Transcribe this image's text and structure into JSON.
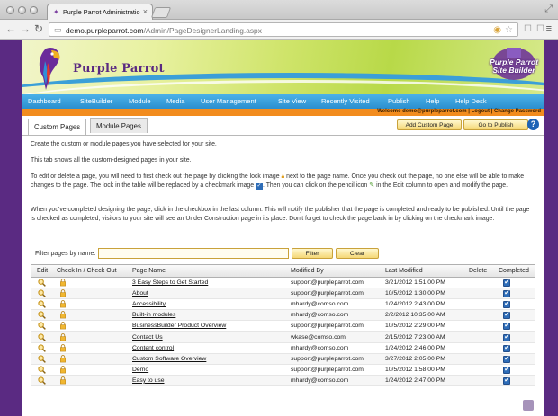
{
  "browser": {
    "tab_title": "Purple Parrot Administratio",
    "url_domain": "demo.purpleparrot.com",
    "url_path": "/Admin/PageDesignerLanding.aspx"
  },
  "brand": {
    "name": "Purple Parrot",
    "site_builder_line1": "Purple Parrot",
    "site_builder_line2": "Site Builder"
  },
  "nav": [
    "Dashboard",
    "SiteBuilder",
    "Module",
    "Media",
    "User Management",
    "Site View",
    "Recently Visited",
    "Publish",
    "Help",
    "Help Desk"
  ],
  "userbar": {
    "text": "Welcome demo@purpleparrot.com | Logout | Change Password"
  },
  "tabs": {
    "custom": "Custom Pages",
    "module": "Module Pages"
  },
  "actions": {
    "add": "Add Custom Page",
    "publish": "Go to Publish"
  },
  "intro": {
    "p1": "Create the custom or module pages you have selected for your site.",
    "p2": "This tab shows all the custom-designed pages in your site.",
    "p3a": "To edit or delete a page, you will need to first check out the page by clicking the lock image",
    "p3b": "next to the page name. Once you check out the page, no one else will be able to make changes to the page. The lock in the table will be replaced by a checkmark image",
    "p3c": ". Then you can click on the pencil icon",
    "p3d": "in the Edit column to open and modify the page.",
    "p4": "When you've completed designing the page, click in the checkbox in the last column. This will notify the publisher that the page is completed and ready to be published. Until the page is checked as completed, visitors to your site will see an Under Construction page in its place. Don't forget to check the page back in by clicking on the checkmark image."
  },
  "filter": {
    "label": "Filter pages by name:",
    "value": "",
    "filter_btn": "Filter",
    "clear_btn": "Clear"
  },
  "grid": {
    "headers": {
      "edit": "Edit",
      "checkin": "Check In / Check Out",
      "name": "Page Name",
      "modified_by": "Modified By",
      "last_modified": "Last Modified",
      "delete": "Delete",
      "completed": "Completed"
    },
    "rows": [
      {
        "name": "3 Easy Steps to Get Started",
        "by": "support@purpleparrot.com",
        "date": "3/21/2012 1:51:00 PM"
      },
      {
        "name": "About",
        "by": "support@purpleparrot.com",
        "date": "10/5/2012 1:30:00 PM"
      },
      {
        "name": "Accessibility",
        "by": "mhardy@comso.com",
        "date": "1/24/2012 2:43:00 PM"
      },
      {
        "name": "Built-in modules",
        "by": "mhardy@comso.com",
        "date": "2/2/2012 10:35:00 AM"
      },
      {
        "name": "BusinessBuilder Product Overview",
        "by": "support@purpleparrot.com",
        "date": "10/5/2012 2:29:00 PM"
      },
      {
        "name": "Contact Us",
        "by": "wkase@comso.com",
        "date": "2/15/2012 7:23:00 AM"
      },
      {
        "name": "Content control",
        "by": "mhardy@comso.com",
        "date": "1/24/2012 2:46:00 PM"
      },
      {
        "name": "Custom Software Overview",
        "by": "support@purpleparrot.com",
        "date": "3/27/2012 2:05:00 PM"
      },
      {
        "name": "Demo",
        "by": "support@purpleparrot.com",
        "date": "10/5/2012 1:58:00 PM"
      },
      {
        "name": "Easy to use",
        "by": "mhardy@comso.com",
        "date": "1/24/2012 2:47:00 PM"
      }
    ]
  }
}
